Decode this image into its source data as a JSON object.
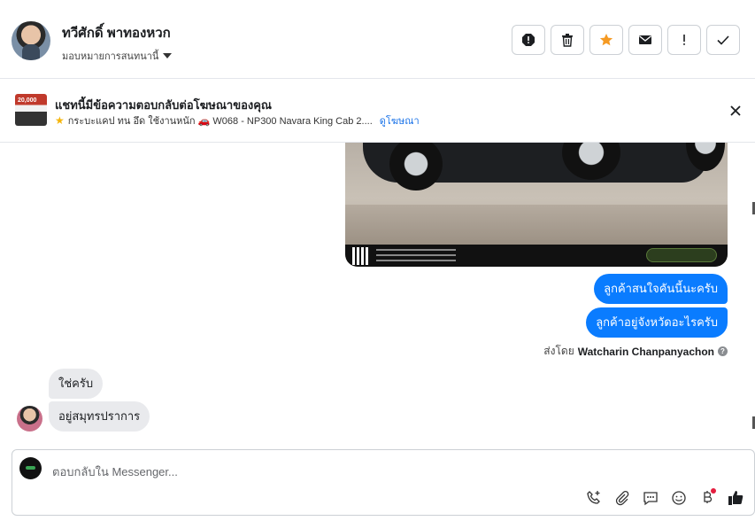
{
  "header": {
    "contact_name": "ทวีศักดิ์ พาทองหวก",
    "assign_label": "มอบหมายการสนทนานี้",
    "actions": [
      "spam-icon",
      "trash-icon",
      "star-icon",
      "mail-icon",
      "exclamation-icon",
      "check-icon"
    ]
  },
  "ad": {
    "title": "แชทนี้มีข้อความตอบกลับต่อโฆษณาของคุณ",
    "thumb_text": "20,000",
    "subtitle": "กระบะแคป ทน อึด ใช้งานหนัก 🚗 W068 - NP300 Navara King Cab 2....",
    "link": "ดูโฆษณา"
  },
  "messages": {
    "outgoing": [
      "ลูกค้าสนใจคันนี้นะครับ",
      "ลูกค้าอยู่จังหวัดอะไรครับ"
    ],
    "sent_by_prefix": "ส่งโดย",
    "sent_by_name": "Watcharin Chanpanyachon",
    "incoming": [
      "ใช่ครับ",
      "อยู่สมุทรปราการ"
    ]
  },
  "composer": {
    "placeholder": "ตอบกลับใน Messenger...",
    "tools": [
      "call-add-icon",
      "attach-icon",
      "saved-reply-icon",
      "emoji-icon",
      "baht-icon",
      "like-icon"
    ]
  },
  "colors": {
    "outgoing_bubble": "#0a7cff",
    "incoming_bubble": "#e9eaed",
    "star": "#f5b50a",
    "link": "#1a73e8"
  }
}
